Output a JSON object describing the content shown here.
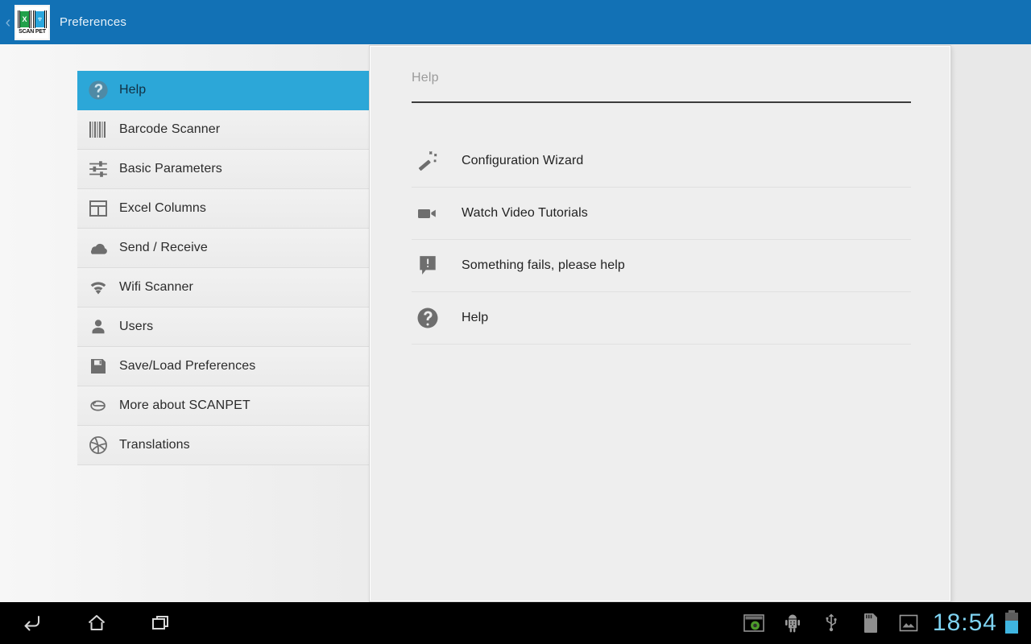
{
  "actionbar": {
    "back_icon": "back-chevron-icon",
    "app_icon": {
      "name": "scanpet-app-icon",
      "left_glyph": "X",
      "right_glyph": "wifi",
      "caption": "SCAN PET"
    },
    "title": "Preferences",
    "background_color": "#1271b5"
  },
  "sidebar": {
    "items": [
      {
        "label": "Help",
        "icon": "help-circle-icon",
        "selected": true
      },
      {
        "label": "Barcode Scanner",
        "icon": "barcode-icon",
        "selected": false
      },
      {
        "label": "Basic Parameters",
        "icon": "sliders-icon",
        "selected": false
      },
      {
        "label": "Excel Columns",
        "icon": "table-grid-icon",
        "selected": false
      },
      {
        "label": "Send / Receive",
        "icon": "cloud-icon",
        "selected": false
      },
      {
        "label": "Wifi Scanner",
        "icon": "wifi-icon",
        "selected": false
      },
      {
        "label": "Users",
        "icon": "person-icon",
        "selected": false
      },
      {
        "label": "Save/Load Preferences",
        "icon": "floppy-disk-icon",
        "selected": false
      },
      {
        "label": "More about SCANPET",
        "icon": "paperclip-icon",
        "selected": false
      },
      {
        "label": "Translations",
        "icon": "globe-icon",
        "selected": false
      }
    ],
    "selected_color": "#2ca7d8"
  },
  "panel": {
    "header": "Help",
    "items": [
      {
        "label": "Configuration Wizard",
        "icon": "magic-wand-icon"
      },
      {
        "label": "Watch Video Tutorials",
        "icon": "video-camera-icon"
      },
      {
        "label": "Something fails, please help",
        "icon": "alert-message-icon"
      },
      {
        "label": "Help",
        "icon": "help-circle-icon"
      }
    ]
  },
  "navbar": {
    "buttons": [
      {
        "name": "back-button",
        "icon": "back-arrow-icon"
      },
      {
        "name": "home-button",
        "icon": "home-icon"
      },
      {
        "name": "recents-button",
        "icon": "recent-apps-icon"
      }
    ],
    "status_icons": [
      {
        "name": "screen-capture-icon"
      },
      {
        "name": "android-debug-icon"
      },
      {
        "name": "usb-icon"
      },
      {
        "name": "sd-card-icon"
      },
      {
        "name": "screenshot-gallery-icon"
      }
    ],
    "clock": "18:54",
    "clock_color": "#7fd3f2",
    "battery": {
      "name": "battery-icon",
      "level_percent": 62,
      "fill_color": "#3fb5e0"
    }
  }
}
